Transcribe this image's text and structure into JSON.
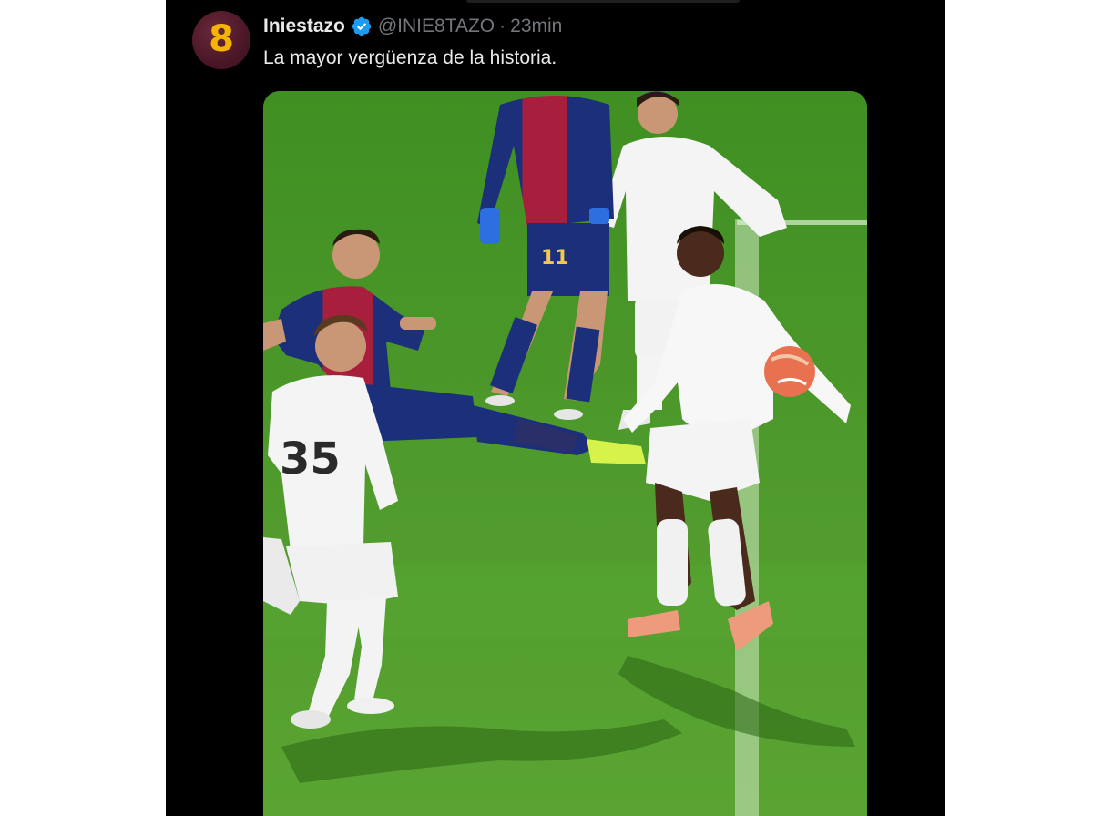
{
  "tweet": {
    "author": {
      "display_name": "Iniestazo",
      "handle": "@INIE8TAZO",
      "avatar_glyph": "8",
      "verified": true
    },
    "separator": "·",
    "time": "23min",
    "text": "La mayor vergüenza de la historia.",
    "media": {
      "kind": "photo",
      "jersey_numbers": [
        "35",
        "11"
      ]
    }
  },
  "colors": {
    "background": "#000000",
    "text_primary": "#e7e9ea",
    "text_secondary": "#71767b",
    "verified_blue": "#1d9bf0",
    "pitch_green": "#4f9a2c"
  },
  "icons": {
    "verified": "verified-badge-icon"
  }
}
